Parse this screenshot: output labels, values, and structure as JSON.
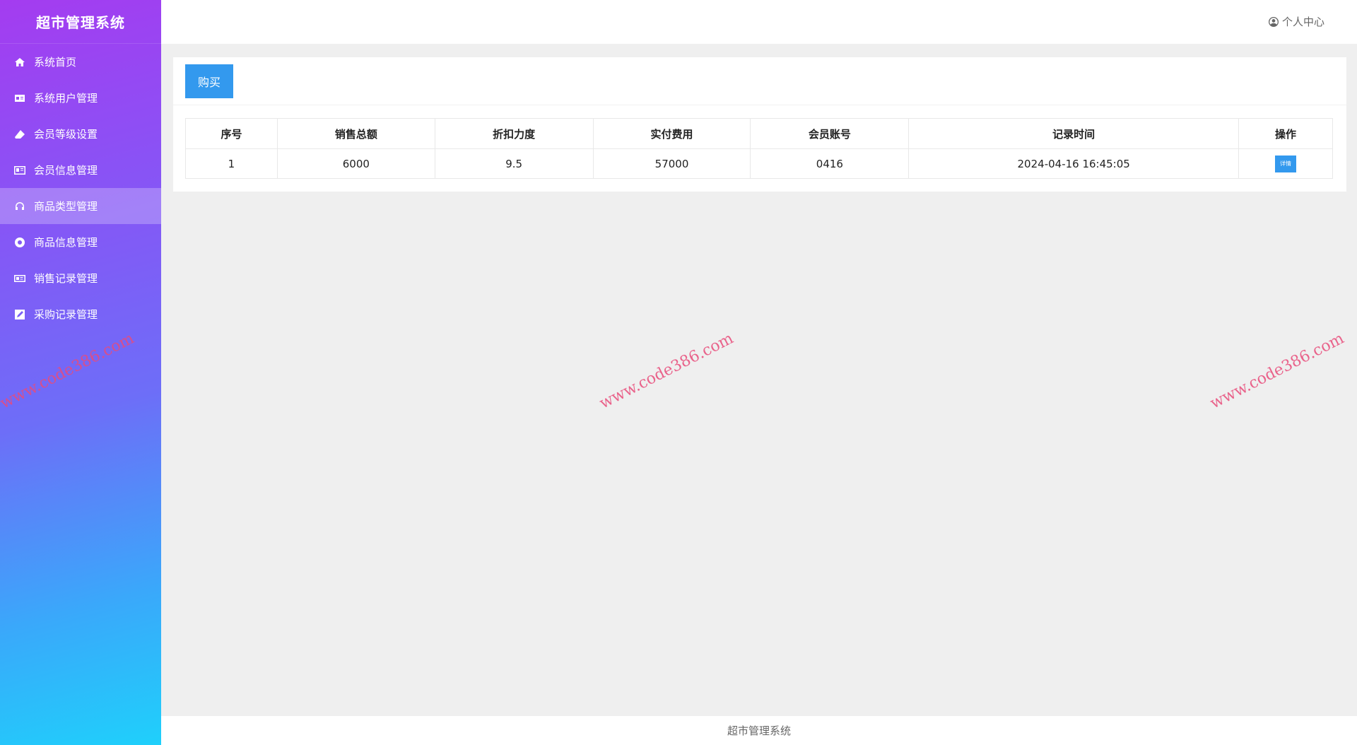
{
  "sidebar": {
    "title": "超市管理系统",
    "items": [
      {
        "label": "系统首页",
        "icon": "home-icon"
      },
      {
        "label": "系统用户管理",
        "icon": "id-card-icon"
      },
      {
        "label": "会员等级设置",
        "icon": "eraser-icon"
      },
      {
        "label": "会员信息管理",
        "icon": "vcard-icon"
      },
      {
        "label": "商品类型管理",
        "icon": "headphones-icon",
        "active": true
      },
      {
        "label": "商品信息管理",
        "icon": "life-ring-icon"
      },
      {
        "label": "销售记录管理",
        "icon": "newspaper-icon"
      },
      {
        "label": "采购记录管理",
        "icon": "edit-icon"
      }
    ]
  },
  "header": {
    "user_center": "个人中心"
  },
  "toolbar": {
    "buy_label": "购买"
  },
  "table": {
    "columns": [
      "序号",
      "销售总额",
      "折扣力度",
      "实付费用",
      "会员账号",
      "记录时间",
      "操作"
    ],
    "rows": [
      {
        "index": "1",
        "total": "6000",
        "discount": "9.5",
        "paid": "57000",
        "member": "0416",
        "time": "2024-04-16 16:45:05",
        "action_label": "详情"
      }
    ]
  },
  "watermark": "www.code386.com",
  "footer": {
    "text": "超市管理系统"
  },
  "colors": {
    "accent": "#3399ee",
    "watermark": "#e94b7a"
  }
}
